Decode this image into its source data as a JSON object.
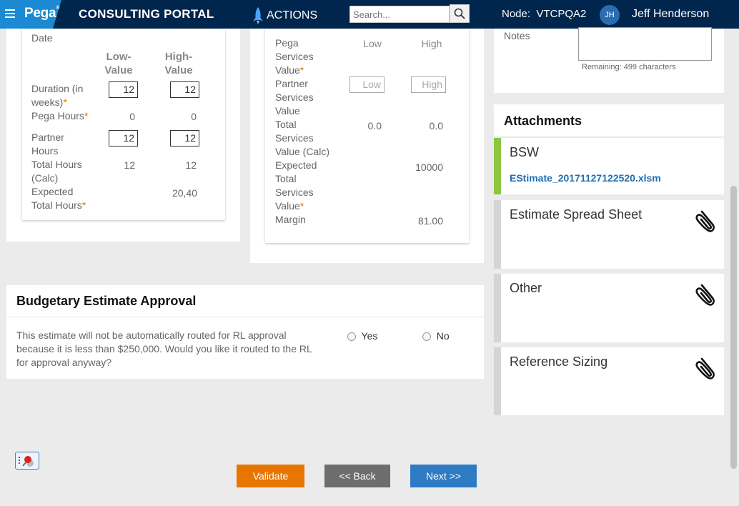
{
  "header": {
    "logo": "Pega",
    "portal_title": "CONSULTING PORTAL",
    "actions_label": "ACTIONS",
    "search_placeholder": "Search...",
    "node_label": "Node:",
    "node_value": "VTCPQA2",
    "avatar_initials": "JH",
    "user_name": "Jeff Henderson"
  },
  "duration_panel": {
    "date_label": "Date",
    "col_low": [
      "Low-",
      "Value"
    ],
    "col_high": [
      "High-",
      "Value"
    ],
    "duration_label": [
      "Duration (in",
      "weeks)"
    ],
    "duration_low": "12",
    "duration_high": "12",
    "pega_hours_label": "Pega Hours",
    "pega_hours_low": "0",
    "pega_hours_high": "0",
    "partner_hours_label": [
      "Partner",
      "Hours"
    ],
    "partner_hours_low": "12",
    "partner_hours_high": "12",
    "total_hours_label": [
      "Total Hours",
      "(Calc)"
    ],
    "total_hours_low": "12",
    "total_hours_high": "12",
    "expected_hours_label": [
      "Expected",
      "Total Hours"
    ],
    "expected_hours_high": "20,40"
  },
  "services_panel": {
    "pega_services_label": [
      "Pega",
      "Services",
      "Value"
    ],
    "col_low": "Low",
    "col_high": "High",
    "partner_services_label": [
      "Partner",
      "Services",
      "Value"
    ],
    "partner_low_placeholder": "Low",
    "partner_high_placeholder": "High",
    "total_services_label": [
      "Total",
      "Services",
      "Value (Calc)"
    ],
    "total_low": "0.0",
    "total_high": "0.0",
    "expected_services_label": [
      "Expected",
      "Total",
      "Services",
      "Value"
    ],
    "expected_high": "10000",
    "margin_label": "Margin",
    "margin_high": "81.00"
  },
  "notes": {
    "label": "Notes",
    "remaining": "Remaining: 499 characters"
  },
  "attachments": {
    "title": "Attachments",
    "items": [
      {
        "title": "BSW",
        "file": "EStimate_20171127122520.xlsm"
      },
      {
        "title": "Estimate Spread Sheet"
      },
      {
        "title": "Other"
      },
      {
        "title": "Reference Sizing"
      }
    ],
    "accent": "#8dc63f"
  },
  "approval": {
    "title": "Budgetary Estimate Approval",
    "question": [
      "This estimate will not be automatically routed for RL approval",
      "because it is less than $250,000. Would you like it routed to the RL",
      "for approval anyway?"
    ],
    "yes": "Yes",
    "no": "No"
  },
  "footer": {
    "validate": "Validate",
    "back": "<< Back",
    "next": "Next >>"
  },
  "colors": {
    "header_bg": "#00264d",
    "brand_bg": "#1b8ad3",
    "validate_bg": "#e87500",
    "back_bg": "#6d6d6d",
    "next_bg": "#2e7bc4",
    "required_star": "#e87500"
  }
}
